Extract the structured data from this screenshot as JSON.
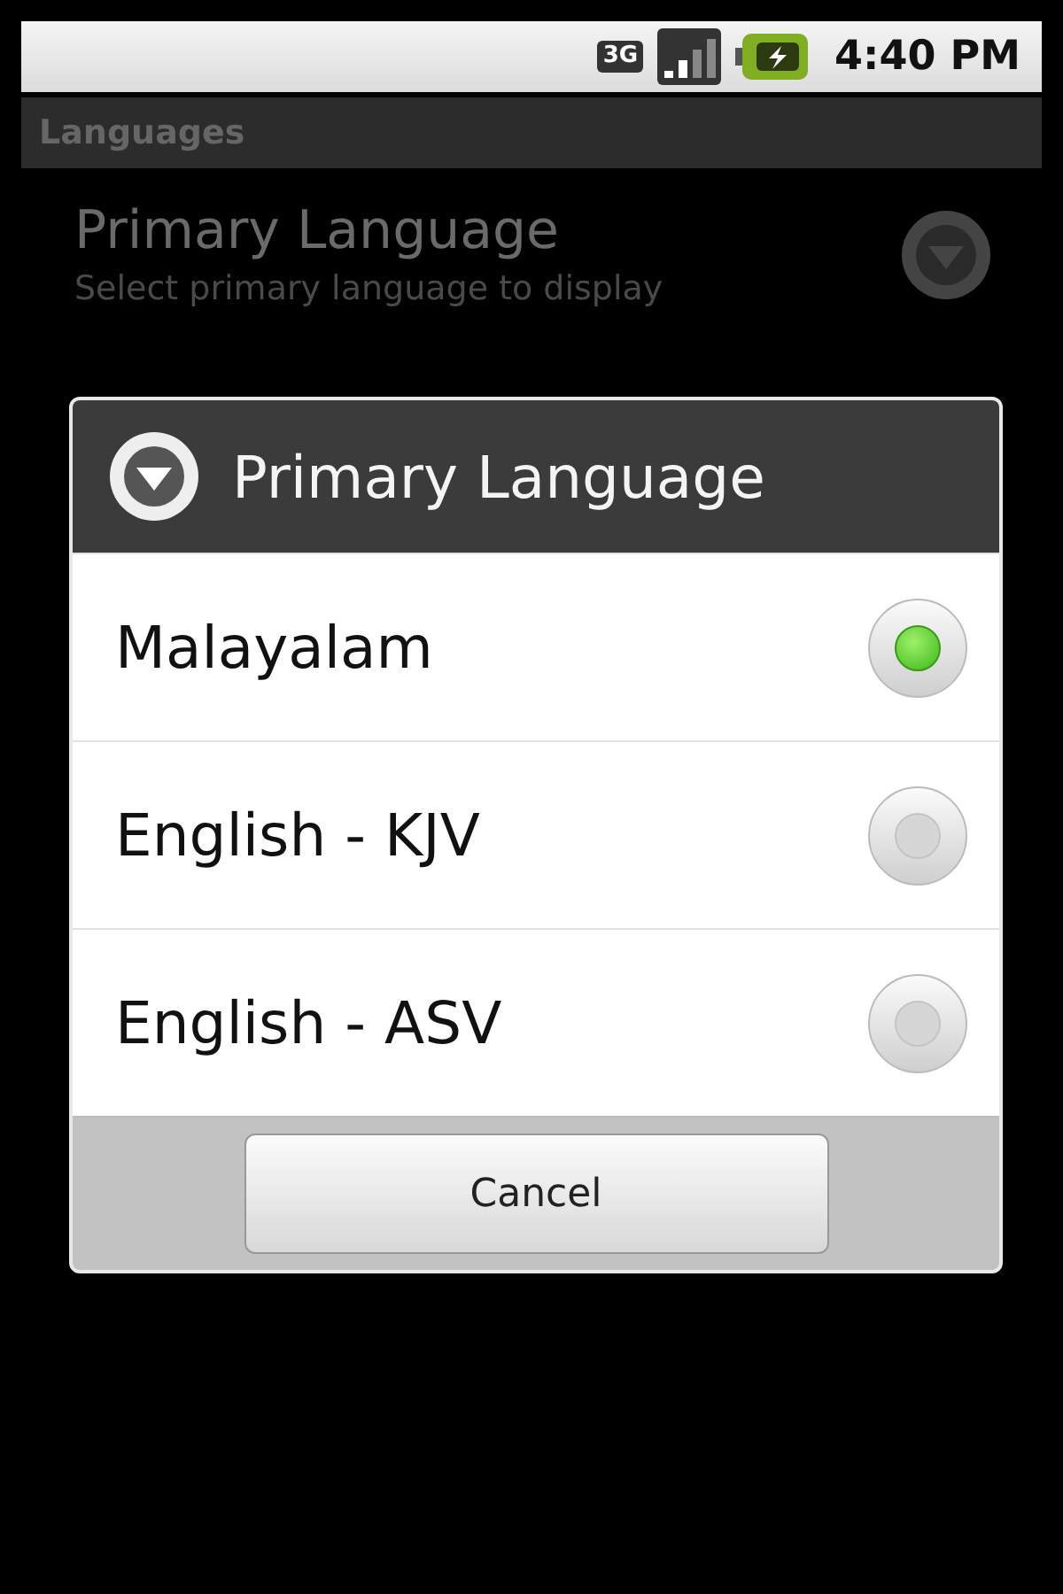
{
  "status_bar": {
    "network": "3G",
    "time": "4:40 PM"
  },
  "title_bar": {
    "title": "Languages"
  },
  "preferences": [
    {
      "title": "Primary Language",
      "summary": "Select primary language to display"
    }
  ],
  "dialog": {
    "title": "Primary Language",
    "options": [
      {
        "label": "Malayalam",
        "selected": true
      },
      {
        "label": "English - KJV",
        "selected": false
      },
      {
        "label": "English - ASV",
        "selected": false
      }
    ],
    "buttons": [
      "Cancel"
    ]
  }
}
